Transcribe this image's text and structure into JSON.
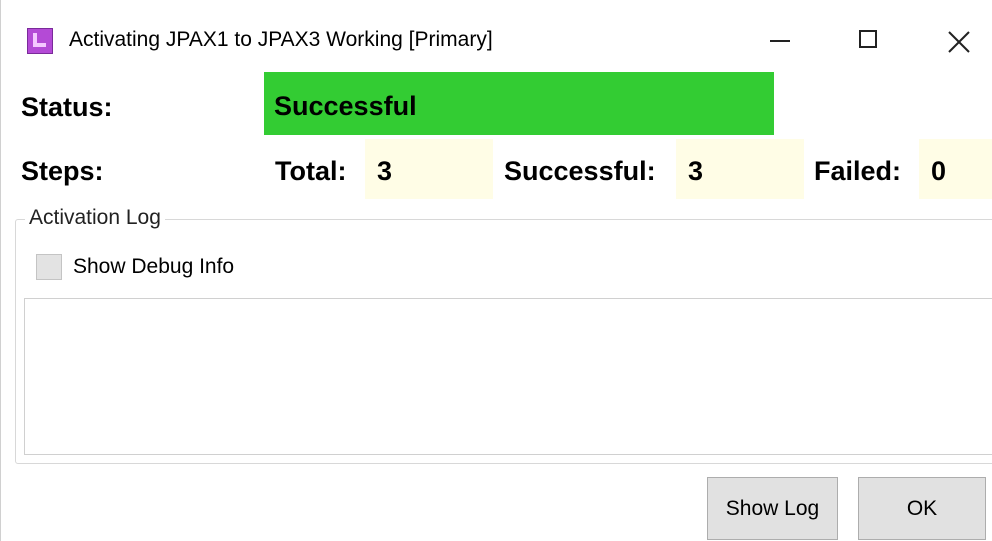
{
  "window": {
    "title": "Activating JPAX1 to JPAX3 Working [Primary]",
    "icon": "app-icon"
  },
  "status": {
    "label": "Status:",
    "value": "Successful",
    "color": "#33cc33"
  },
  "steps": {
    "label": "Steps:",
    "total_label": "Total:",
    "total_value": "3",
    "successful_label": "Successful:",
    "successful_value": "3",
    "failed_label": "Failed:",
    "failed_value": "0"
  },
  "log": {
    "group_title": "Activation Log",
    "debug_checkbox_label": "Show Debug Info",
    "debug_checked": false,
    "content": ""
  },
  "buttons": {
    "show_log": "Show Log",
    "ok": "OK"
  }
}
